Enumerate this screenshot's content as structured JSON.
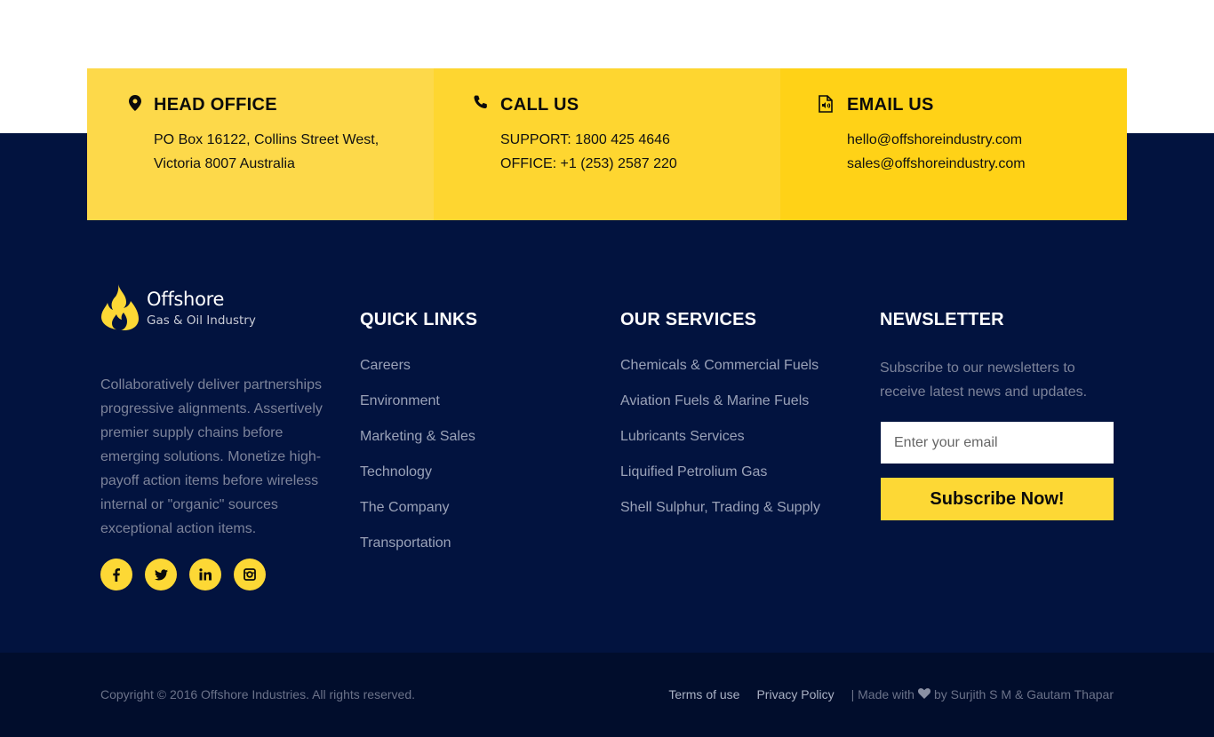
{
  "contact": {
    "head_office": {
      "title": "HEAD OFFICE",
      "icon": "map-pin-icon",
      "line1": "PO Box 16122, Collins Street West,",
      "line2": "Victoria 8007 Australia"
    },
    "call_us": {
      "title": "CALL US",
      "icon": "phone-icon",
      "line1": "SUPPORT: 1800 425 4646",
      "line2": "OFFICE: +1 (253) 2587 220"
    },
    "email_us": {
      "title": "EMAIL US",
      "icon": "email-file-icon",
      "line1": "hello@offshoreindustry.com",
      "line2": "sales@offshoreindustry.com"
    }
  },
  "brand": {
    "name": "Offshore",
    "tagline": "Gas & Oil Industry",
    "about": "Collaboratively deliver partnerships progressive alignments. Assertively premier supply chains before emerging solutions. Monetize high-payoff action items before wireless internal or \"organic\" sources exceptional action items.",
    "socials": [
      {
        "icon": "facebook-icon",
        "glyph": "f"
      },
      {
        "icon": "twitter-icon",
        "glyph": "t"
      },
      {
        "icon": "linkedin-icon",
        "glyph": "in"
      },
      {
        "icon": "instagram-icon",
        "glyph": "ig"
      }
    ]
  },
  "quick_links": {
    "title": "QUICK LINKS",
    "items": [
      "Careers",
      "Environment",
      "Marketing & Sales",
      "Technology",
      "The Company",
      "Transportation"
    ]
  },
  "services": {
    "title": "OUR SERVICES",
    "items": [
      "Chemicals & Commercial Fuels",
      "Aviation Fuels & Marine Fuels",
      "Lubricants Services",
      "Liquified Petrolium Gas",
      "Shell Sulphur, Trading & Supply"
    ]
  },
  "newsletter": {
    "title": "NEWSLETTER",
    "text": "Subscribe to our newsletters to receive latest news and updates.",
    "placeholder": "Enter your email",
    "button": "Subscribe Now!"
  },
  "footer": {
    "copyright": "Copyright © 2016 Offshore Industries. All rights reserved.",
    "terms": "Terms of use",
    "privacy": "Privacy Policy",
    "made_prefix": "| Made with",
    "made_suffix": "by Surjith S M & Gautam Thapar"
  },
  "colors": {
    "navy": "#02133f",
    "footer_bar": "#010d2c",
    "accent_yellow": "#fdd835"
  }
}
